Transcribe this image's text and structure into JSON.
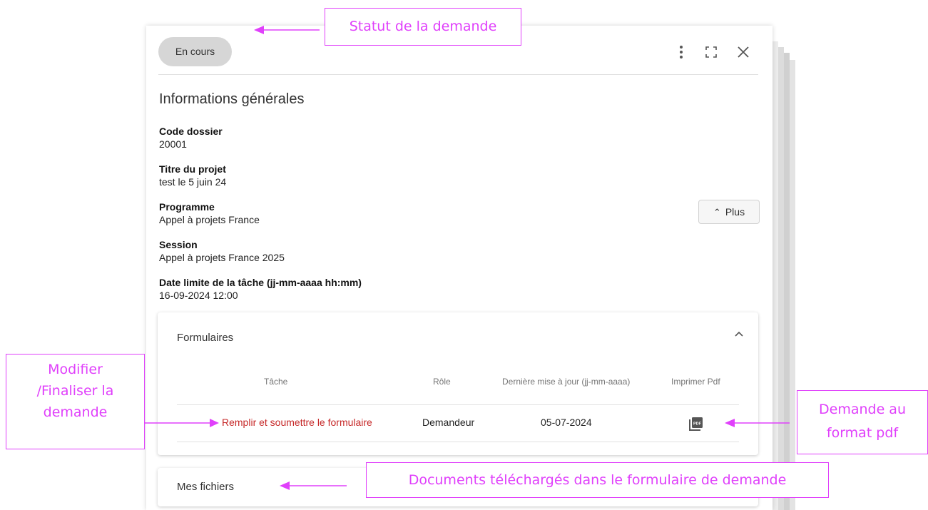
{
  "status_chip": "En cours",
  "header": {
    "icons": [
      "more-vert-icon",
      "fullscreen-icon",
      "close-icon"
    ]
  },
  "section_title": "Informations générales",
  "fields": [
    {
      "label": "Code dossier",
      "value": "20001"
    },
    {
      "label": "Titre du projet",
      "value": "test le 5 juin 24"
    },
    {
      "label": "Programme",
      "value": "Appel à projets France"
    },
    {
      "label": "Session",
      "value": "Appel à projets France 2025"
    },
    {
      "label": "Date limite de la tâche (jj-mm-aaaa hh:mm)",
      "value": "16-09-2024 12:00"
    }
  ],
  "plus_button": "Plus",
  "forms": {
    "title": "Formulaires",
    "headers": [
      "Tâche",
      "Rôle",
      "Dernière mise à jour (jj-mm-aaaa)",
      "Imprimer Pdf"
    ],
    "row": {
      "task": "Remplir et soumettre le formulaire",
      "role": "Demandeur",
      "date": "05-07-2024"
    }
  },
  "files": {
    "title": "Mes fichiers"
  },
  "annotations": {
    "status": "Statut de la demande",
    "modify_line1": "Modifier",
    "modify_line2": "/Finaliser la",
    "modify_line3": "demande",
    "pdf_line1": "Demande au",
    "pdf_line2": "format pdf",
    "documents": "Documents téléchargés dans le formulaire de demande"
  },
  "colors": {
    "annotation": "#e040fb",
    "task_link": "#c62828",
    "chip": "#d6d6d6"
  }
}
